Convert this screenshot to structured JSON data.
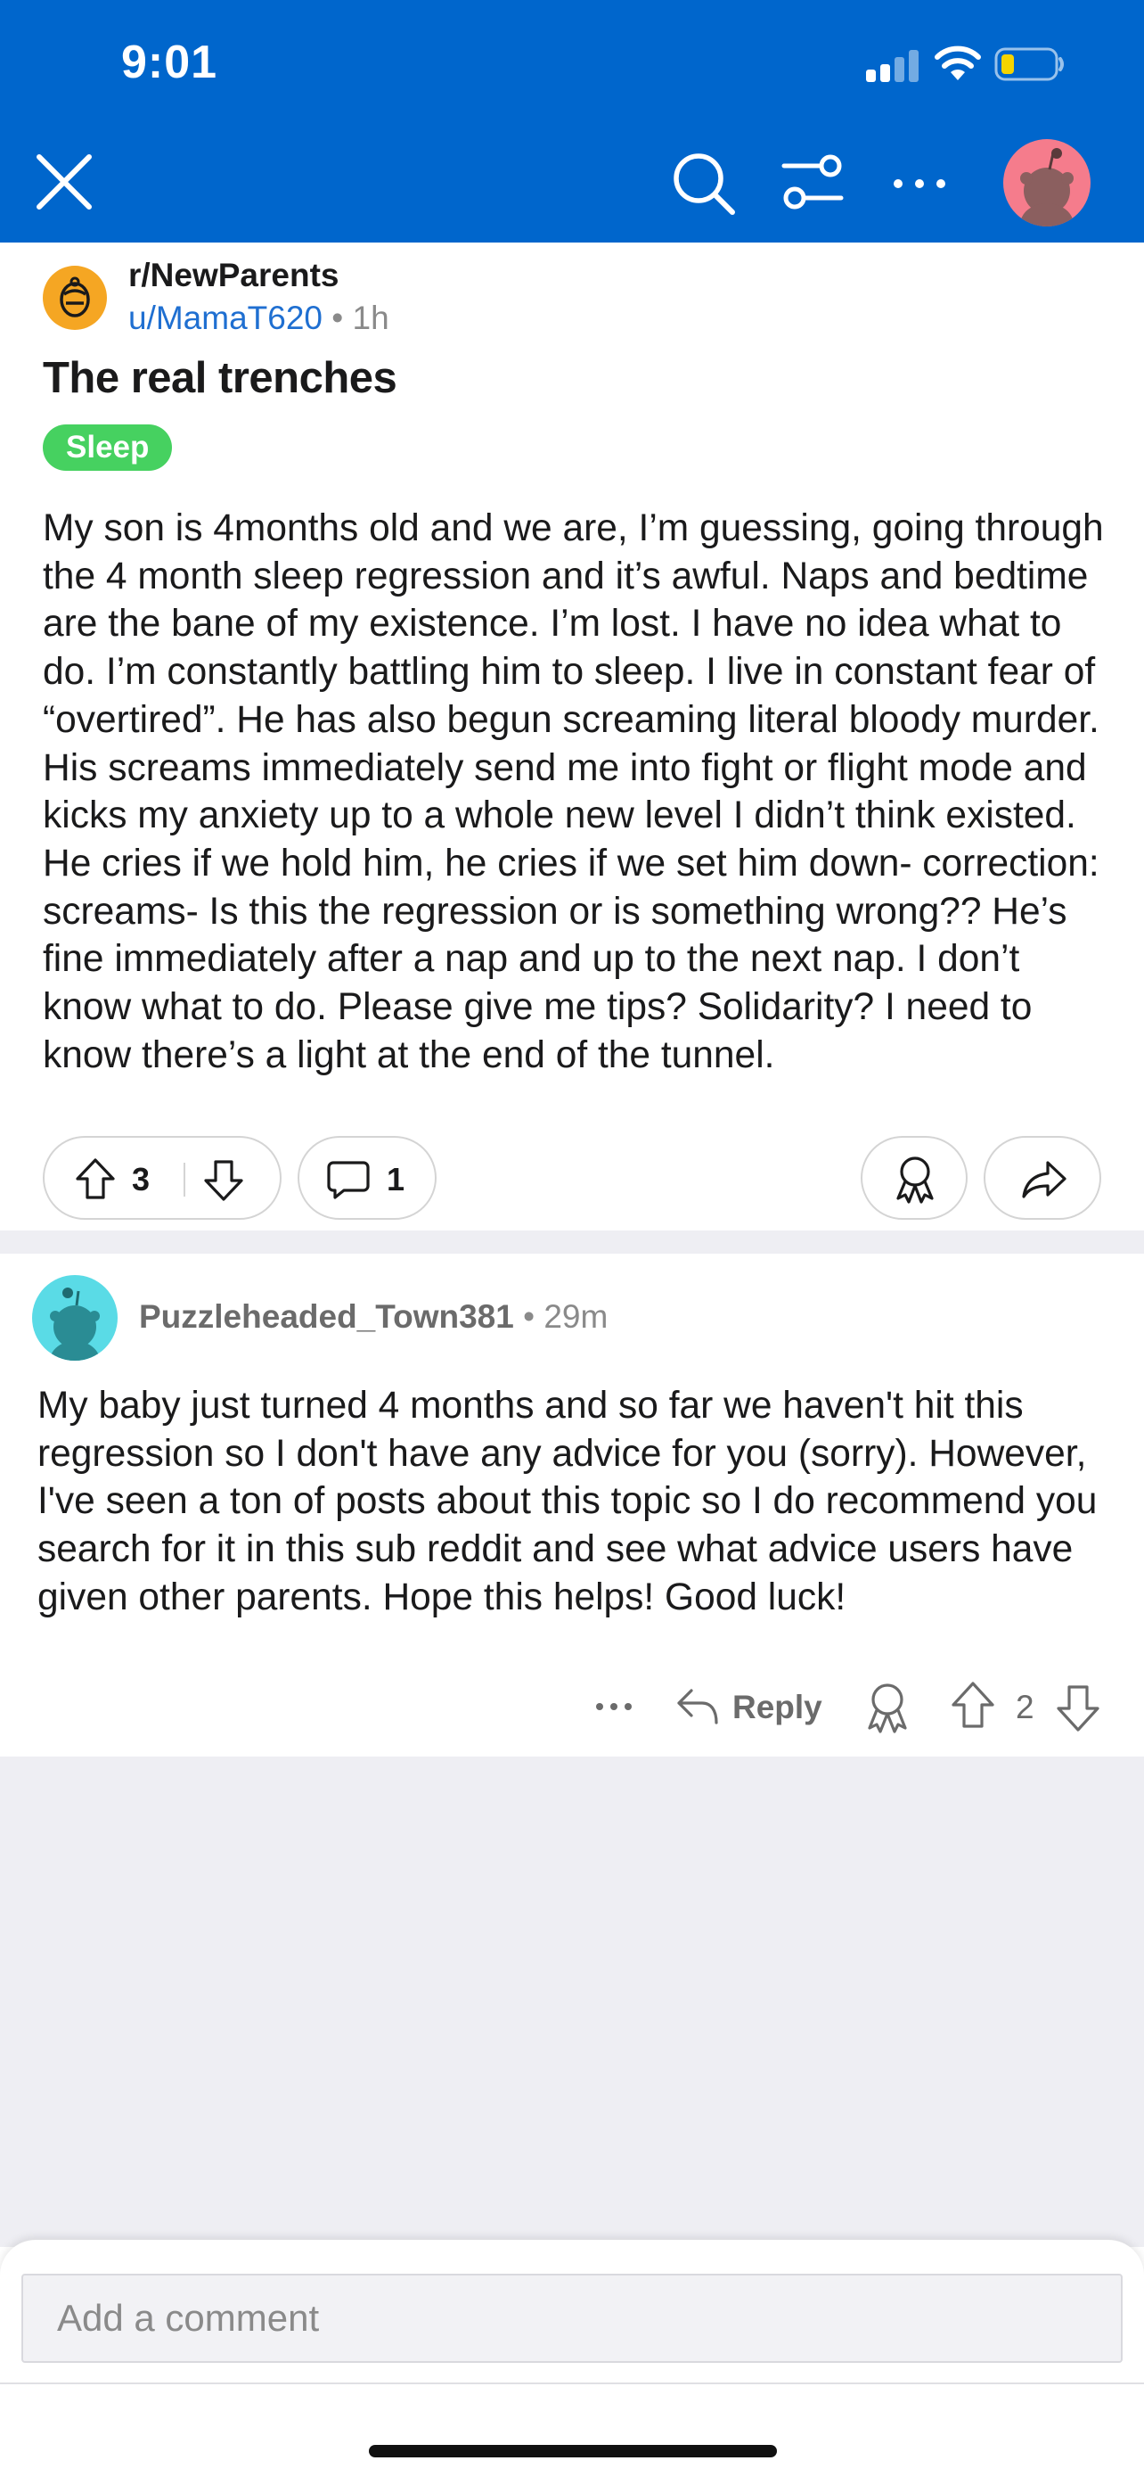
{
  "status_bar": {
    "time": "9:01",
    "battery_level": 0.2
  },
  "nav": {
    "icons": [
      "close-icon",
      "search-icon",
      "filter-icon",
      "more-icon",
      "avatar"
    ]
  },
  "post": {
    "subreddit": "r/NewParents",
    "author": "u/MamaT620",
    "separator": "•",
    "age": "1h",
    "title": "The real trenches",
    "flair": "Sleep",
    "body": "My son is 4months old and we are, I’m guessing, going through the 4 month sleep regression and it’s awful. Naps and bedtime are the bane of my existence. I’m lost. I have no idea what to do. I’m constantly battling him to sleep. I live in constant fear of “overtired”. He has also begun screaming literal bloody murder. His screams immediately send me into fight or flight mode and kicks my anxiety up to a whole new level I didn’t think existed. He cries if we hold him, he cries if we set him down- correction: screams- Is this the regression or is something wrong?? He’s fine immediately after a nap and up to the next nap. I don’t know what to do. Please give me tips? Solidarity? I need to know there’s a light at the end of the tunnel.",
    "votes": "3",
    "comments": "1"
  },
  "comment": {
    "author": "Puzzleheaded_Town381",
    "separator": "•",
    "age": "29m",
    "body": "My baby just turned 4 months and so far we haven't hit this regression so I don't have any advice for you (sorry). However, I've seen a ton of posts about this topic so I do recommend you search for it in this sub reddit and see what advice users have given other parents. Hope this helps! Good luck!",
    "reply_label": "Reply",
    "score": "2"
  },
  "composer": {
    "placeholder": "Add a comment"
  },
  "colors": {
    "header_bg": "#0066cc",
    "flair_bg": "#46d160",
    "author_link": "#1f6fd1",
    "subreddit_icon": "#f5a623",
    "comment_avatar": "#5adbe6",
    "battery_fill": "#f5d400"
  }
}
